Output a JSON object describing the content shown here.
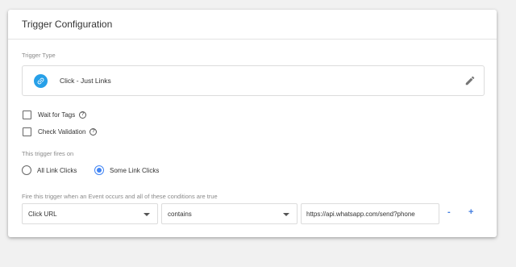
{
  "card": {
    "title": "Trigger Configuration"
  },
  "trigger_type": {
    "label": "Trigger Type",
    "name": "Click - Just Links",
    "icon": "link-icon",
    "badge_color": "#27a0e8"
  },
  "options": {
    "wait_for_tags": {
      "label": "Wait for Tags",
      "checked": false
    },
    "check_validation": {
      "label": "Check Validation",
      "checked": false
    }
  },
  "fires_on": {
    "label": "This trigger fires on",
    "choices": [
      {
        "label": "All Link Clicks",
        "selected": false
      },
      {
        "label": "Some Link Clicks",
        "selected": true
      }
    ]
  },
  "condition": {
    "label": "Fire this trigger when an Event occurs and all of these conditions are true",
    "variable": "Click URL",
    "operator": "contains",
    "value": "https://api.whatsapp.com/send?phone",
    "remove_label": "-",
    "add_label": "+"
  },
  "colors": {
    "accent": "#4285f4",
    "link_blue": "#3f7be0"
  }
}
